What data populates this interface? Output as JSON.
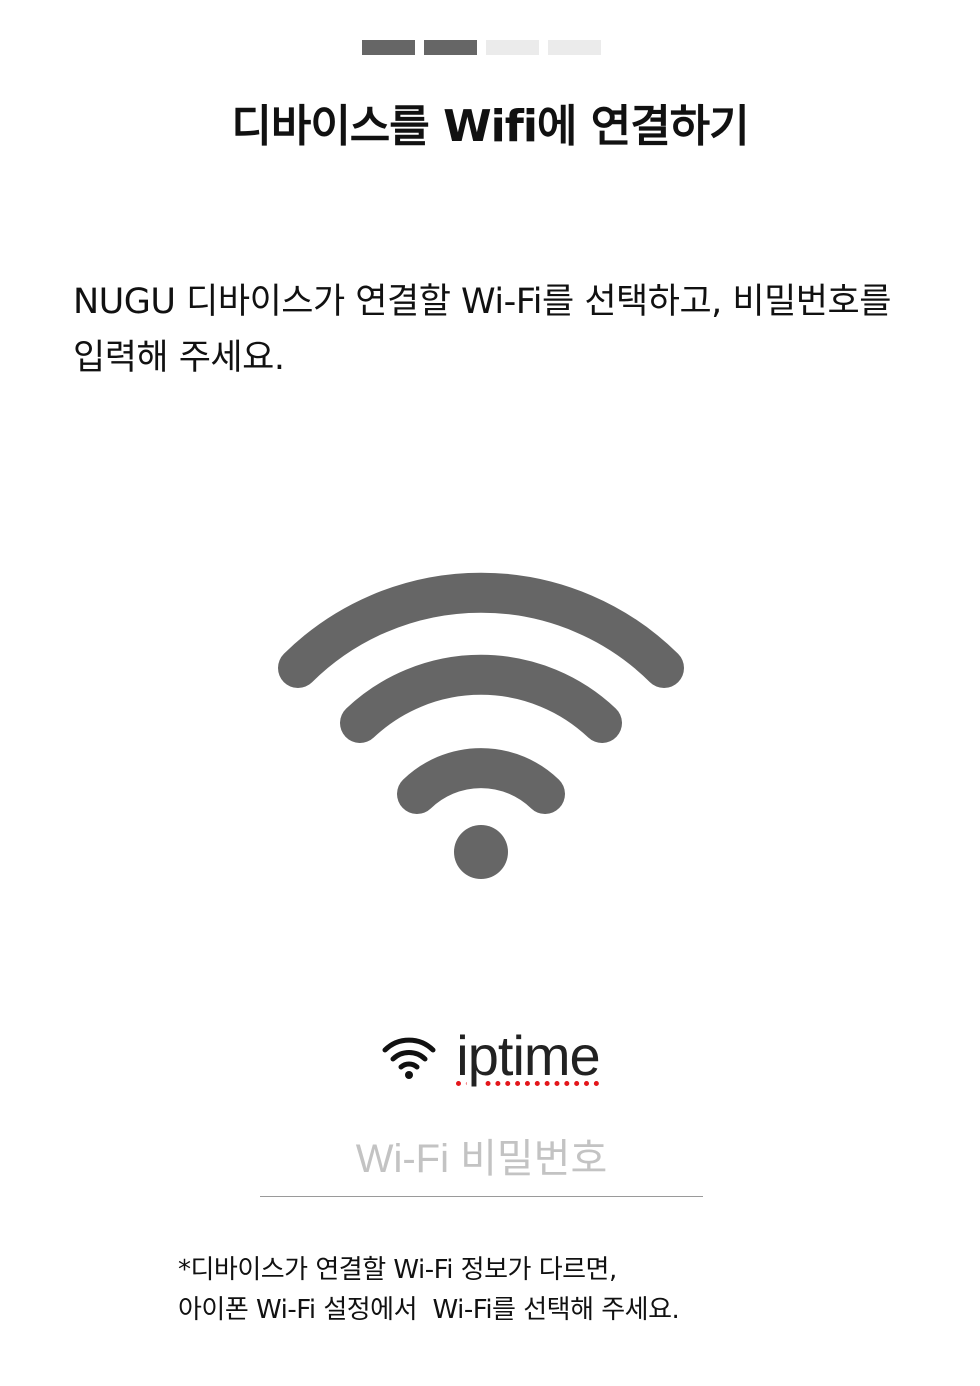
{
  "progress": {
    "total_steps": 4,
    "completed_steps": 2
  },
  "title": "디바이스를 Wifi에 연결하기",
  "instruction": "NUGU 디바이스가 연결할 Wi-Fi를 선택하고, 비밀번호를 입력해 주세요.",
  "icons": {
    "main": "wifi-icon",
    "network": "wifi-signal-icon"
  },
  "network": {
    "ssid": "iptime"
  },
  "password": {
    "placeholder": "Wi-Fi 비밀번호",
    "value": ""
  },
  "footnote": {
    "line1": "*디바이스가 연결할 Wi-Fi 정보가 다르면,",
    "line2": "아이폰 Wi-Fi 설정에서  Wi-Fi를 선택해 주세요."
  },
  "colors": {
    "step_done": "#666666",
    "step_pending": "#ebebeb",
    "icon": "#666666",
    "spellcheck_underline": "#e4161b",
    "placeholder": "#c3c3c3"
  }
}
